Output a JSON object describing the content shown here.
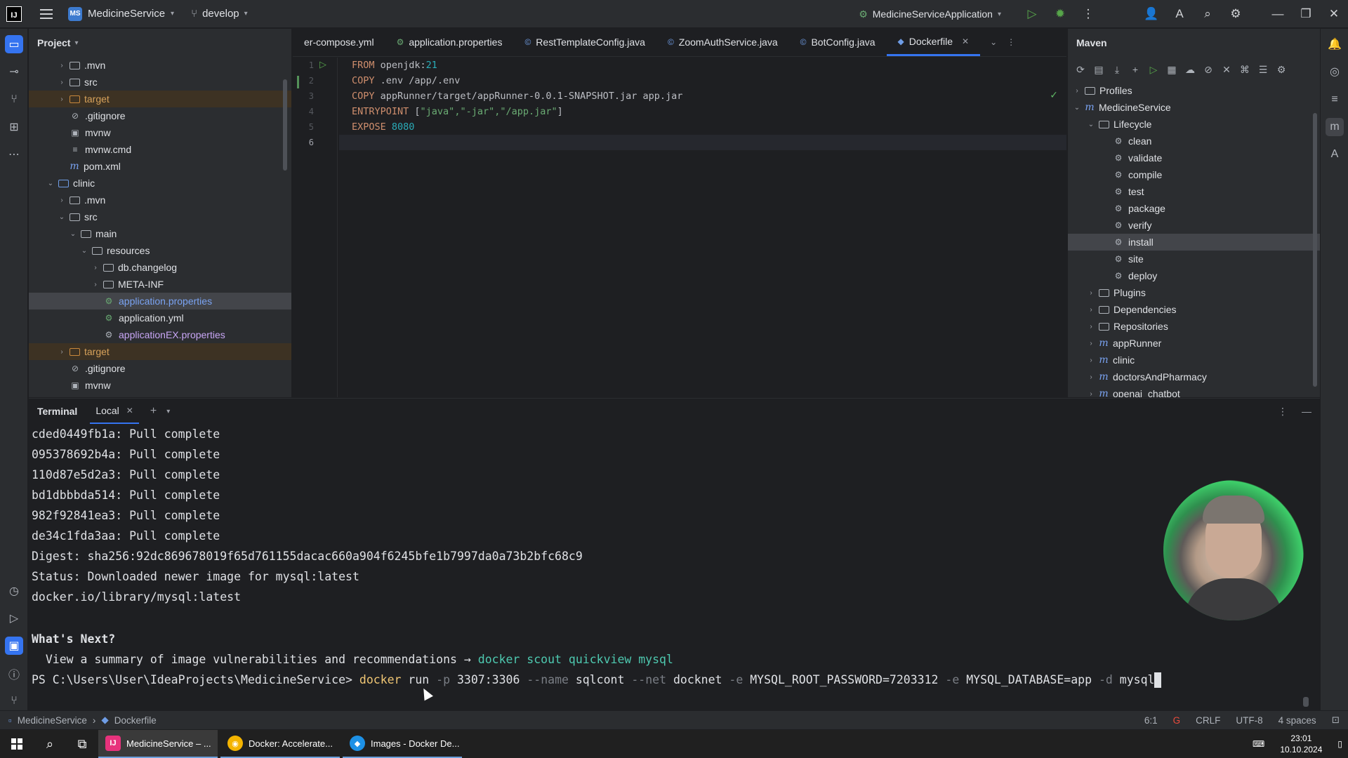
{
  "titlebar": {
    "logo_text": "IJ",
    "project_badge": "MS",
    "project_name": "MedicineService",
    "branch": "develop",
    "run_config": "MedicineServiceApplication"
  },
  "project_panel": {
    "title": "Project",
    "items": [
      {
        "label": ".mvn",
        "indent": 1,
        "arrow": "right",
        "type": "folder"
      },
      {
        "label": "src",
        "indent": 1,
        "arrow": "right",
        "type": "folder"
      },
      {
        "label": "target",
        "indent": 1,
        "arrow": "right",
        "type": "folder-orange",
        "excluded": true
      },
      {
        "label": ".gitignore",
        "indent": 1,
        "arrow": "",
        "type": "ignore"
      },
      {
        "label": "mvnw",
        "indent": 1,
        "arrow": "",
        "type": "file"
      },
      {
        "label": "mvnw.cmd",
        "indent": 1,
        "arrow": "",
        "type": "text"
      },
      {
        "label": "pom.xml",
        "indent": 1,
        "arrow": "",
        "type": "maven"
      },
      {
        "label": "clinic",
        "indent": 0,
        "arrow": "down",
        "type": "folder-blue"
      },
      {
        "label": ".mvn",
        "indent": 1,
        "arrow": "right",
        "type": "folder"
      },
      {
        "label": "src",
        "indent": 1,
        "arrow": "down",
        "type": "folder"
      },
      {
        "label": "main",
        "indent": 2,
        "arrow": "down",
        "type": "folder"
      },
      {
        "label": "resources",
        "indent": 3,
        "arrow": "down",
        "type": "folder"
      },
      {
        "label": "db.changelog",
        "indent": 4,
        "arrow": "right",
        "type": "folder"
      },
      {
        "label": "META-INF",
        "indent": 4,
        "arrow": "right",
        "type": "folder"
      },
      {
        "label": "application.properties",
        "indent": 4,
        "arrow": "",
        "type": "props",
        "selected": true,
        "color": "blue"
      },
      {
        "label": "application.yml",
        "indent": 4,
        "arrow": "",
        "type": "props"
      },
      {
        "label": "applicationEX.properties",
        "indent": 4,
        "arrow": "",
        "type": "gear",
        "color": "purple"
      },
      {
        "label": "target",
        "indent": 1,
        "arrow": "right",
        "type": "folder-orange",
        "excluded": true
      },
      {
        "label": ".gitignore",
        "indent": 1,
        "arrow": "",
        "type": "ignore"
      },
      {
        "label": "mvnw",
        "indent": 1,
        "arrow": "",
        "type": "file"
      }
    ]
  },
  "editor": {
    "tabs": [
      {
        "label": "er-compose.yml",
        "icon": "docker-compose-icon"
      },
      {
        "label": "application.properties",
        "icon": "properties-icon"
      },
      {
        "label": "RestTemplateConfig.java",
        "icon": "java-class-icon"
      },
      {
        "label": "ZoomAuthService.java",
        "icon": "java-class-icon"
      },
      {
        "label": "BotConfig.java",
        "icon": "java-class-icon"
      },
      {
        "label": "Dockerfile",
        "icon": "docker-icon",
        "active": true
      }
    ],
    "line_numbers": [
      "1",
      "2",
      "3",
      "4",
      "5",
      "6"
    ],
    "code": {
      "l1_kw": "FROM",
      "l1_rest": " openjdk:",
      "l1_num": "21",
      "l2_kw": "COPY",
      "l2_rest": " .env /app/.env",
      "l3_kw": "COPY",
      "l3_rest": " appRunner/target/appRunner-0.0.1-SNAPSHOT.jar app.jar",
      "l4_kw": "ENTRYPOINT",
      "l4_rest": " [",
      "l4_str": "\"java\",\"-jar\",\"/app.jar\"",
      "l4_end": "]",
      "l5_kw": "EXPOSE",
      "l5_num": " 8080"
    }
  },
  "maven": {
    "title": "Maven",
    "items": [
      {
        "label": "Profiles",
        "indent": 0,
        "arrow": "right",
        "type": "folder"
      },
      {
        "label": "MedicineService",
        "indent": 0,
        "arrow": "down",
        "type": "maven"
      },
      {
        "label": "Lifecycle",
        "indent": 1,
        "arrow": "down",
        "type": "folder"
      },
      {
        "label": "clean",
        "indent": 2,
        "arrow": "",
        "type": "gear"
      },
      {
        "label": "validate",
        "indent": 2,
        "arrow": "",
        "type": "gear"
      },
      {
        "label": "compile",
        "indent": 2,
        "arrow": "",
        "type": "gear"
      },
      {
        "label": "test",
        "indent": 2,
        "arrow": "",
        "type": "gear"
      },
      {
        "label": "package",
        "indent": 2,
        "arrow": "",
        "type": "gear"
      },
      {
        "label": "verify",
        "indent": 2,
        "arrow": "",
        "type": "gear"
      },
      {
        "label": "install",
        "indent": 2,
        "arrow": "",
        "type": "gear",
        "selected": true
      },
      {
        "label": "site",
        "indent": 2,
        "arrow": "",
        "type": "gear"
      },
      {
        "label": "deploy",
        "indent": 2,
        "arrow": "",
        "type": "gear"
      },
      {
        "label": "Plugins",
        "indent": 1,
        "arrow": "right",
        "type": "folder"
      },
      {
        "label": "Dependencies",
        "indent": 1,
        "arrow": "right",
        "type": "folder"
      },
      {
        "label": "Repositories",
        "indent": 1,
        "arrow": "right",
        "type": "folder"
      },
      {
        "label": "appRunner",
        "indent": 1,
        "arrow": "right",
        "type": "maven"
      },
      {
        "label": "clinic",
        "indent": 1,
        "arrow": "right",
        "type": "maven"
      },
      {
        "label": "doctorsAndPharmacy",
        "indent": 1,
        "arrow": "right",
        "type": "maven"
      },
      {
        "label": "openai_chatbot",
        "indent": 1,
        "arrow": "right",
        "type": "maven"
      }
    ]
  },
  "terminal": {
    "title": "Terminal",
    "tab": "Local",
    "lines": [
      "cded0449fb1a: Pull complete",
      "095378692b4a: Pull complete",
      "110d87e5d2a3: Pull complete",
      "bd1dbbbda514: Pull complete",
      "982f92841ea3: Pull complete",
      "de34c1fda3aa: Pull complete",
      "Digest: sha256:92dc869678019f65d761155dacac660a904f6245bfe1b7997da0a73b2bfc68c9",
      "Status: Downloaded newer image for mysql:latest",
      "docker.io/library/mysql:latest"
    ],
    "whats_next": "What's Next?",
    "summary_text": "  View a summary of image vulnerabilities and recommendations → ",
    "summary_cmd": "docker scout quickview mysql",
    "prompt": "PS C:\\Users\\User\\IdeaProjects\\MedicineService> ",
    "cmd_docker": "docker",
    "cmd_run": " run ",
    "cmd_p": "-p",
    "cmd_port": " 3307:3306 ",
    "cmd_name_flag": "--name",
    "cmd_name": " sqlcont ",
    "cmd_net_flag": "--net",
    "cmd_net": " docknet ",
    "cmd_e1": "-e",
    "cmd_env1": " MYSQL_ROOT_PASSWORD=7203312 ",
    "cmd_e2": "-e",
    "cmd_env2": " MYSQL_DATABASE=app ",
    "cmd_d": "-d",
    "cmd_img": " mysql"
  },
  "statusbar": {
    "crumb_project": "MedicineService",
    "crumb_file": "Dockerfile",
    "position": "6:1",
    "line_sep": "CRLF",
    "encoding": "UTF-8",
    "indent": "4 spaces"
  },
  "taskbar": {
    "apps": [
      {
        "label": "MedicineService – ...",
        "icon": "intellij-icon",
        "active": true
      },
      {
        "label": "Docker: Accelerate...",
        "icon": "chrome-icon"
      },
      {
        "label": "Images - Docker De...",
        "icon": "docker-desktop-icon"
      }
    ],
    "time": "23:01",
    "date": "10.10.2024"
  },
  "colors": {
    "accent": "#3574f0",
    "keyword": "#cf8e6d",
    "string": "#6aab73",
    "number": "#2aacb8"
  }
}
